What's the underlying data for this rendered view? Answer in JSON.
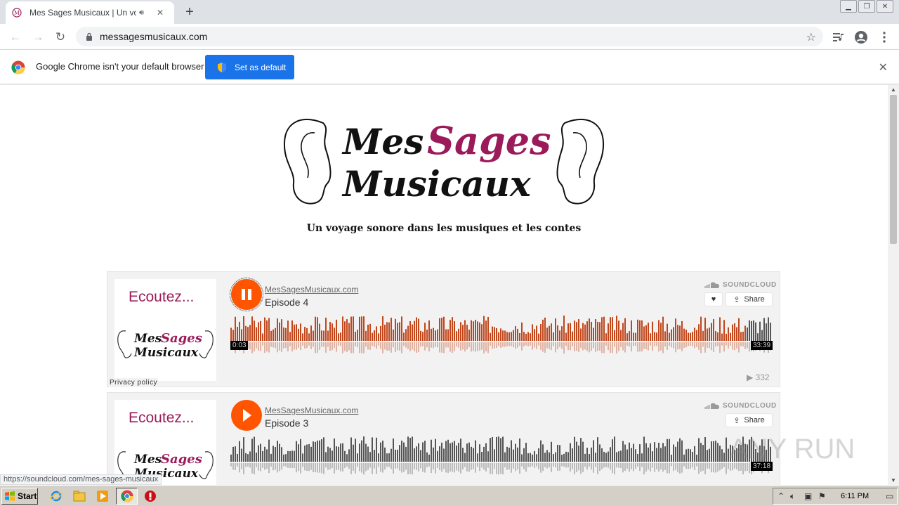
{
  "browser": {
    "tab_title": "Mes Sages Musicaux | Un voyage sonore dans les musiques et les contes",
    "url": "messagesmusicaux.com",
    "infobar_message": "Google Chrome isn't your default browser",
    "set_default_label": "Set as default",
    "status_url": "https://soundcloud.com/mes-sages-musicaux"
  },
  "page": {
    "tagline": "Un voyage sonore dans les musiques et les contes",
    "logo_line1": "Mes",
    "logo_line1_accent": "Sages",
    "logo_line2": "Musicaux"
  },
  "players": [
    {
      "art_text": "Ecoutez...",
      "user": "MesSagesMusicaux.com",
      "title": "Episode 4",
      "brand": "SOUNDCLOUD",
      "share_label": "Share",
      "elapsed": "0:03",
      "duration": "33:39",
      "plays": "332",
      "privacy": "Privacy policy",
      "state": "playing",
      "progress": 0.955
    },
    {
      "art_text": "Ecoutez...",
      "user": "MesSagesMusicaux.com",
      "title": "Episode 3",
      "brand": "SOUNDCLOUD",
      "share_label": "Share",
      "duration": "37:18",
      "state": "paused",
      "progress": 0
    }
  ],
  "taskbar": {
    "start_label": "Start",
    "clock": "6:11 PM"
  },
  "watermark": "ANY RUN",
  "colors": {
    "accent": "#ff5500",
    "brand_pink": "#9b1b5a",
    "chrome_blue": "#1a73e8"
  }
}
